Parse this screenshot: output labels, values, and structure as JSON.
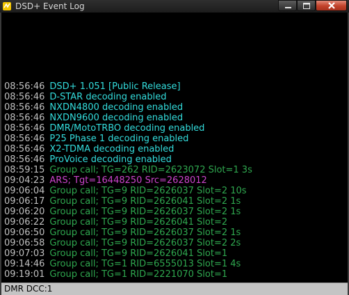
{
  "window": {
    "title": "DSD+ Event Log",
    "icon": "dsd-app-icon"
  },
  "colors": {
    "timestamp": "#c0c0c0",
    "info": "#33dddd",
    "group_call": "#2fa84f",
    "ars": "#cc44cc",
    "log_background": "#000000",
    "status_bar": "#c4c4c4"
  },
  "log": [
    {
      "time": "08:56:46",
      "message": "DSD+ 1.051  [Public Release]",
      "kind": "info"
    },
    {
      "time": "08:56:46",
      "message": "D-STAR decoding enabled",
      "kind": "info"
    },
    {
      "time": "08:56:46",
      "message": "NXDN4800 decoding enabled",
      "kind": "info"
    },
    {
      "time": "08:56:46",
      "message": "NXDN9600 decoding enabled",
      "kind": "info"
    },
    {
      "time": "08:56:46",
      "message": "DMR/MotoTRBO decoding enabled",
      "kind": "info"
    },
    {
      "time": "08:56:46",
      "message": "P25 Phase 1 decoding enabled",
      "kind": "info"
    },
    {
      "time": "08:56:46",
      "message": "X2-TDMA decoding enabled",
      "kind": "info"
    },
    {
      "time": "08:56:46",
      "message": "ProVoice decoding enabled",
      "kind": "info"
    },
    {
      "time": "08:59:15",
      "message": "Group call; TG=262 RID=2623072  Slot=1  3s",
      "kind": "group_call"
    },
    {
      "time": "09:04:23",
      "message": "ARS; Tgt=16448250 Src=2628012",
      "kind": "ars"
    },
    {
      "time": "09:06:04",
      "message": "Group call; TG=9 RID=2626037  Slot=2  10s",
      "kind": "group_call"
    },
    {
      "time": "09:06:17",
      "message": "Group call; TG=9 RID=2626041  Slot=2  1s",
      "kind": "group_call"
    },
    {
      "time": "09:06:20",
      "message": "Group call; TG=9 RID=2626037  Slot=2  1s",
      "kind": "group_call"
    },
    {
      "time": "09:06:22",
      "message": "Group call; TG=9 RID=2626041  Slot=2",
      "kind": "group_call"
    },
    {
      "time": "09:06:50",
      "message": "Group call; TG=9 RID=2626037  Slot=2  1s",
      "kind": "group_call"
    },
    {
      "time": "09:06:58",
      "message": "Group call; TG=9 RID=2626037  Slot=2  2s",
      "kind": "group_call"
    },
    {
      "time": "09:07:03",
      "message": "Group call; TG=9 RID=2626041  Slot=1",
      "kind": "group_call"
    },
    {
      "time": "09:14:46",
      "message": "Group call; TG=1 RID=6555013  Slot=1  4s",
      "kind": "group_call"
    },
    {
      "time": "09:19:01",
      "message": "Group call; TG=1 RID=2221070  Slot=1",
      "kind": "group_call"
    }
  ],
  "status_bar": {
    "text": "DMR  DCC:1"
  }
}
